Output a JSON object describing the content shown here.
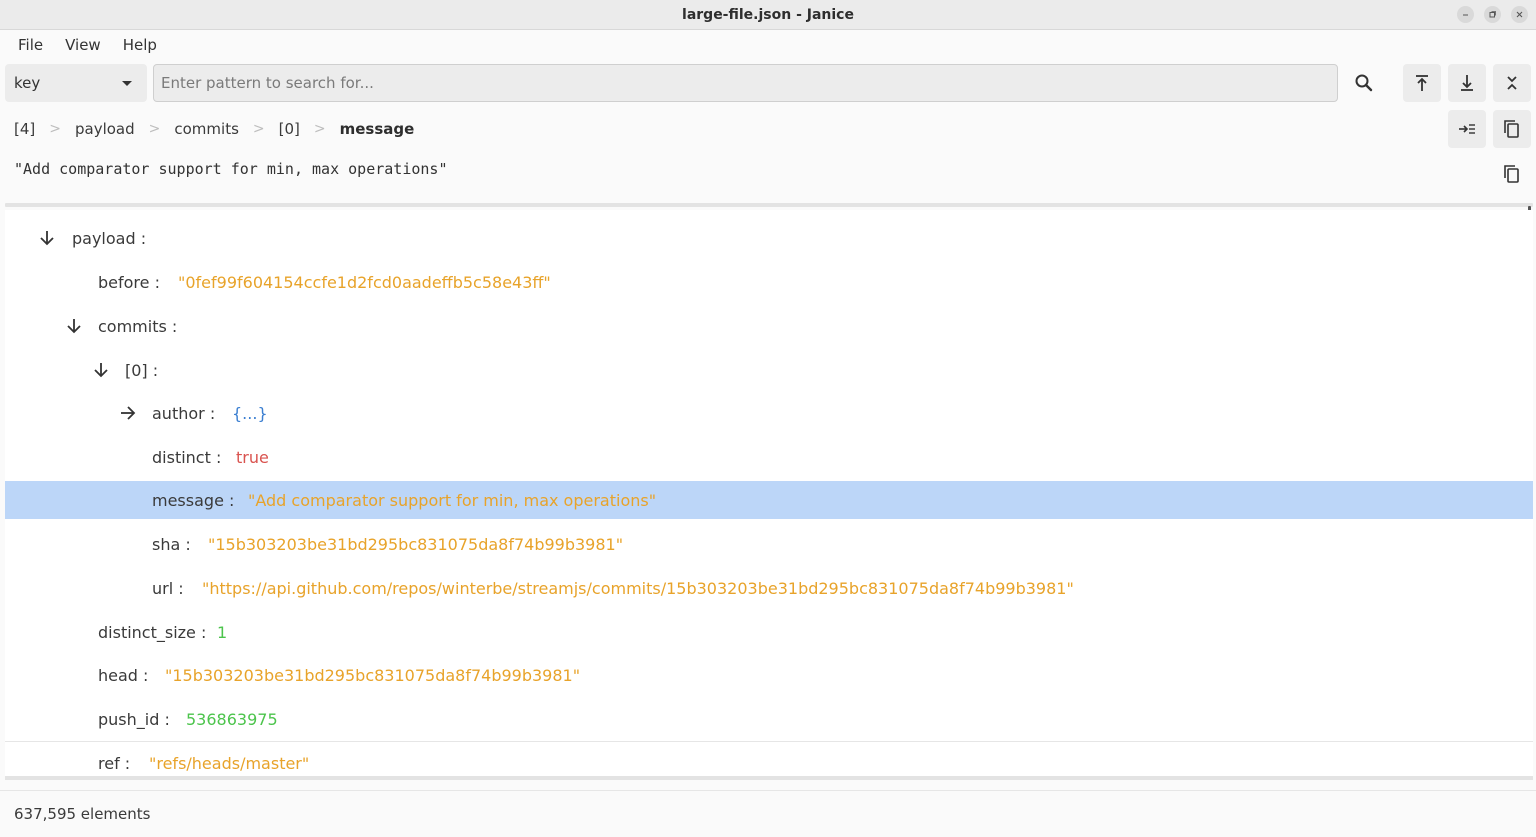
{
  "window": {
    "title": "large-file.json - Janice",
    "controls": [
      "minimize",
      "restore",
      "close"
    ]
  },
  "menubar": {
    "items": [
      "File",
      "View",
      "Help"
    ]
  },
  "search": {
    "mode": "key",
    "placeholder": "Enter pattern to search for..."
  },
  "toolbar": {
    "search_icon": "search-icon",
    "top_icon": "jump-to-top-icon",
    "bottom_icon": "jump-to-bottom-icon",
    "collapse_icon": "collapse-all-icon",
    "path_copy_icon": "copy-path-icon",
    "value_copy_icon": "copy-value-icon",
    "jump_icon": "go-to-path-icon"
  },
  "breadcrumb": {
    "items": [
      "[4]",
      "payload",
      "commits",
      "[0]",
      "message"
    ],
    "separator": ">"
  },
  "value_preview": "\"Add comparator support for min, max operations\"",
  "tree": {
    "rows": [
      {
        "key": "payload :",
        "value": "",
        "type": "none",
        "arrow": "down"
      },
      {
        "key": "before :",
        "value": "\"0fef99f604154ccfe1d2fcd0aadeffb5c58e43ff\"",
        "type": "string",
        "arrow": ""
      },
      {
        "key": "commits :",
        "value": "",
        "type": "none",
        "arrow": "down"
      },
      {
        "key": "[0] :",
        "value": "",
        "type": "none",
        "arrow": "down"
      },
      {
        "key": "author :",
        "value": "{...}",
        "type": "object",
        "arrow": "right"
      },
      {
        "key": "distinct :",
        "value": "true",
        "type": "bool",
        "arrow": ""
      },
      {
        "key": "message :",
        "value": "\"Add comparator support for min, max operations\"",
        "type": "string",
        "arrow": "",
        "selected": true
      },
      {
        "key": "sha :",
        "value": "\"15b303203be31bd295bc831075da8f74b99b3981\"",
        "type": "string",
        "arrow": ""
      },
      {
        "key": "url :",
        "value": "\"https://api.github.com/repos/winterbe/streamjs/commits/15b303203be31bd295bc831075da8f74b99b3981\"",
        "type": "string",
        "arrow": ""
      },
      {
        "key": "distinct_size :",
        "value": "1",
        "type": "number",
        "arrow": ""
      },
      {
        "key": "head :",
        "value": "\"15b303203be31bd295bc831075da8f74b99b3981\"",
        "type": "string",
        "arrow": ""
      },
      {
        "key": "push_id :",
        "value": "536863975",
        "type": "number",
        "arrow": ""
      },
      {
        "key": "ref :",
        "value": "\"refs/heads/master\"",
        "type": "string",
        "arrow": ""
      }
    ]
  },
  "status": {
    "elements": "637,595 elements"
  },
  "colors": {
    "string": "#e8a32a",
    "bool": "#d9534f",
    "number": "#4cc44c",
    "object": "#3b7fd1",
    "selection": "#bcd6f8"
  }
}
